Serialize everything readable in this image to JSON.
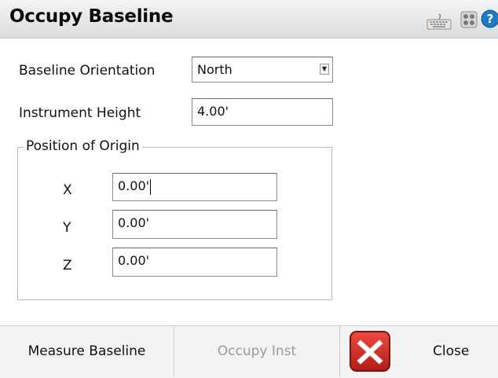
{
  "window": {
    "title": "Occupy Baseline"
  },
  "title_icons": [
    "keyboard-icon",
    "quad-grid-icon",
    "help-icon"
  ],
  "fields": {
    "baseline_orientation": {
      "label": "Baseline Orientation",
      "value": "North"
    },
    "instrument_height": {
      "label": "Instrument Height",
      "value": "4.00'"
    }
  },
  "origin": {
    "title": "Position of Origin",
    "x": {
      "label": "X",
      "value": "0.00'"
    },
    "y": {
      "label": "Y",
      "value": "0.00'"
    },
    "z": {
      "label": "Z",
      "value": "0.00'"
    }
  },
  "buttons": {
    "measure_baseline": "Measure Baseline",
    "occupy_inst": "Occupy Inst",
    "close": "Close"
  },
  "colors": {
    "close_icon": "#c8231d",
    "disabled_text": "#9a9a9a",
    "help_icon": "#1f78c8"
  }
}
